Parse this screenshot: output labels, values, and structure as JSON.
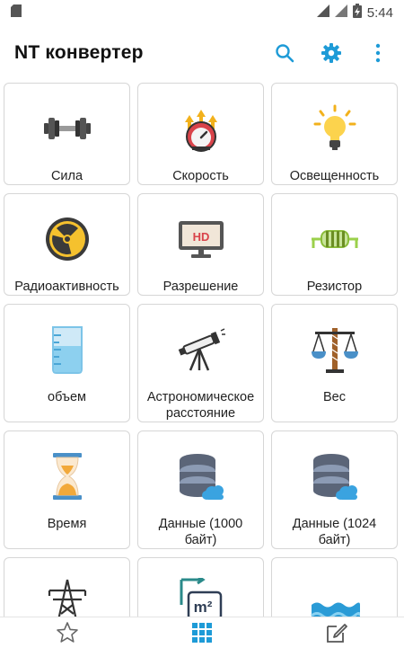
{
  "status_bar": {
    "time": "5:44"
  },
  "app_bar": {
    "title": "NT конвертер",
    "icons": [
      "search-icon",
      "gear-icon",
      "more-vert-icon"
    ]
  },
  "colors": {
    "accent": "#1e9bd7",
    "card_border": "#d6d6d6"
  },
  "categories": [
    {
      "label": "Сила",
      "icon": "dumbbell-icon"
    },
    {
      "label": "Скорость",
      "icon": "speedometer-icon"
    },
    {
      "label": "Освещенность",
      "icon": "lightbulb-icon"
    },
    {
      "label": "Радиоактивность",
      "icon": "radiation-icon"
    },
    {
      "label": "Разрешение",
      "icon": "hd-monitor-icon"
    },
    {
      "label": "Резистор",
      "icon": "resistor-icon"
    },
    {
      "label": "объем",
      "icon": "beaker-icon"
    },
    {
      "label": "Астрономическое расстояние",
      "icon": "telescope-icon"
    },
    {
      "label": "Вес",
      "icon": "scales-icon"
    },
    {
      "label": "Время",
      "icon": "hourglass-icon"
    },
    {
      "label": "Данные (1000 байт)",
      "icon": "database-cloud-icon"
    },
    {
      "label": "Данные (1024 байт)",
      "icon": "database-cloud-icon"
    },
    {
      "label": "",
      "icon": "power-tower-icon"
    },
    {
      "label": "",
      "icon": "area-m2-icon"
    },
    {
      "label": "",
      "icon": "water-icon"
    }
  ],
  "bottom_nav": [
    "star-icon",
    "grid-icon",
    "edit-icon"
  ]
}
